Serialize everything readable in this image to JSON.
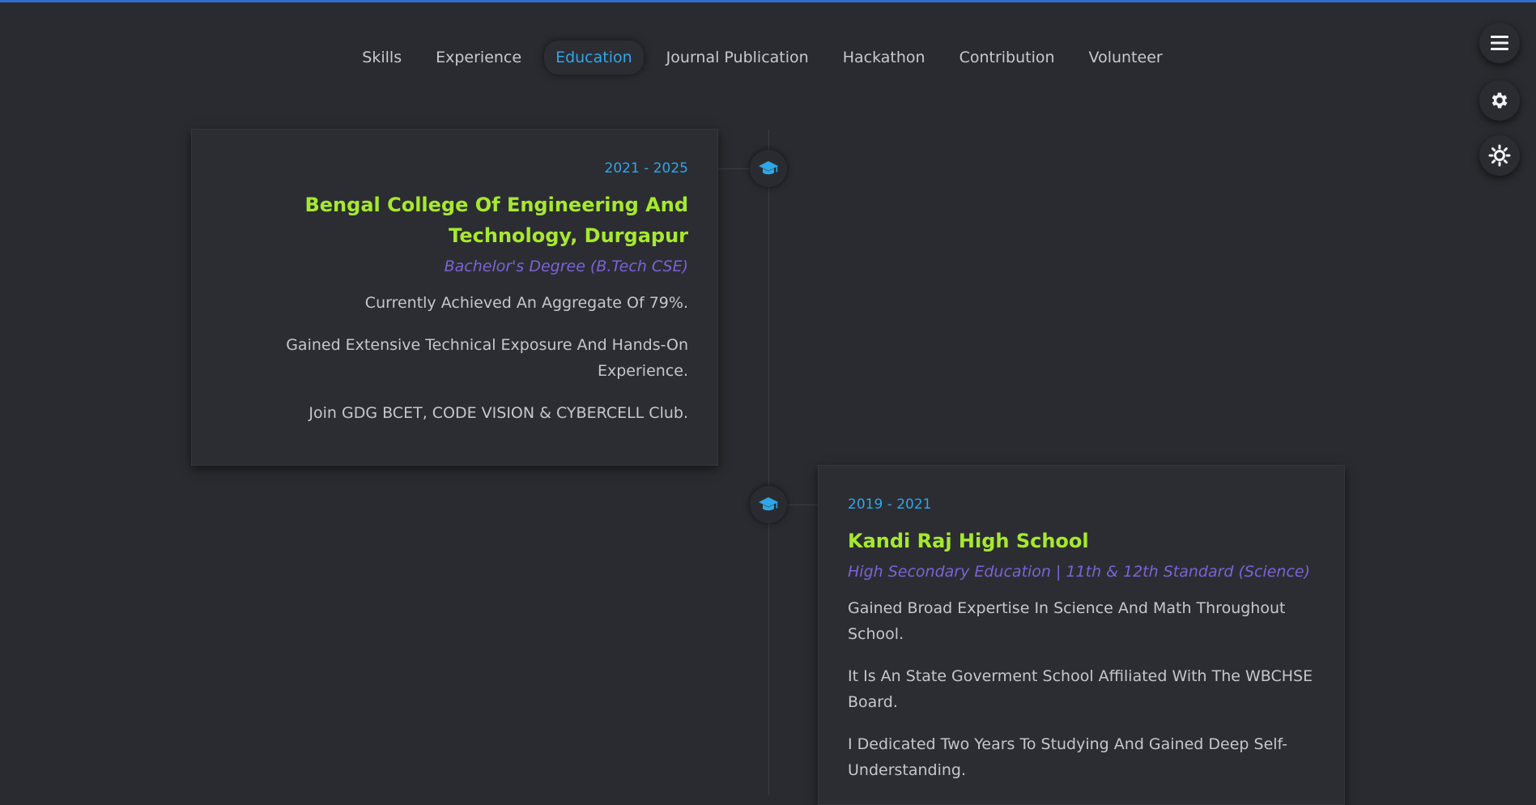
{
  "nav": {
    "items": [
      {
        "label": "Skills"
      },
      {
        "label": "Experience"
      },
      {
        "label": "Education"
      },
      {
        "label": "Journal Publication"
      },
      {
        "label": "Hackathon"
      },
      {
        "label": "Contribution"
      },
      {
        "label": "Volunteer"
      }
    ],
    "active": "Education"
  },
  "fab_buttons": [
    {
      "icon": "hamburger-menu-icon"
    },
    {
      "icon": "gear-icon"
    },
    {
      "icon": "sun-icon"
    }
  ],
  "education": [
    {
      "date": "2021 - 2025",
      "institution": "Bengal College Of Engineering And Technology, Durgapur",
      "degree": "Bachelor's Degree (B.Tech CSE)",
      "points": [
        "Currently Achieved An Aggregate Of 79%.",
        "Gained Extensive Technical Exposure And Hands-On Experience.",
        "Join GDG BCET, CODE VISION & CYBERCELL Club."
      ],
      "icon": "graduation-cap-icon"
    },
    {
      "date": "2019 - 2021",
      "institution": "Kandi Raj High School",
      "degree": "High Secondary Education | 11th & 12th Standard (Science)",
      "points": [
        "Gained Broad Expertise In Science And Math Throughout School.",
        "It Is An State Goverment School Affiliated With The WBCHSE Board.",
        "I Dedicated Two Years To Studying And Gained Deep Self-Understanding."
      ],
      "icon": "graduation-cap-icon"
    }
  ],
  "colors": {
    "background": "#2a2b30",
    "accent_blue": "#2fa6e6",
    "title_green": "#a6e92e",
    "degree_purple": "#7a63d8",
    "top_bar": "#2f6fd0"
  }
}
